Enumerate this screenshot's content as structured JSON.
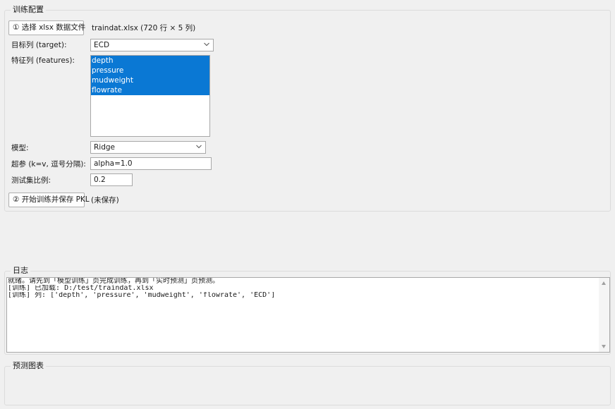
{
  "train_group": {
    "title": "训练配置",
    "select_file_button": "① 选择 xlsx 数据文件",
    "file_info": "traindat.xlsx  (720 行 × 5 列)",
    "target_label": "目标列 (target):",
    "target_value": "ECD",
    "features_label": "特征列 (features):",
    "features": [
      "depth",
      "pressure",
      "mudweight",
      "flowrate"
    ],
    "model_label": "模型:",
    "model_value": "Ridge",
    "hyper_label": "超参 (k=v, 逗号分隔):",
    "hyper_value": "alpha=1.0",
    "test_ratio_label": "测试集比例:",
    "test_ratio_value": "0.2",
    "train_button": "② 开始训练并保存 PKL",
    "save_status": "(未保存)"
  },
  "log_group": {
    "title": "日志",
    "lines": [
      "就绪。请先到「模型训练」页完成训练，再到「实时预测」页预测。",
      "[训练] 已加载: D:/test/traindat.xlsx",
      "[训练] 列: ['depth', 'pressure', 'mudweight', 'flowrate', 'ECD']"
    ]
  },
  "chart_group": {
    "title": "预测图表"
  }
}
